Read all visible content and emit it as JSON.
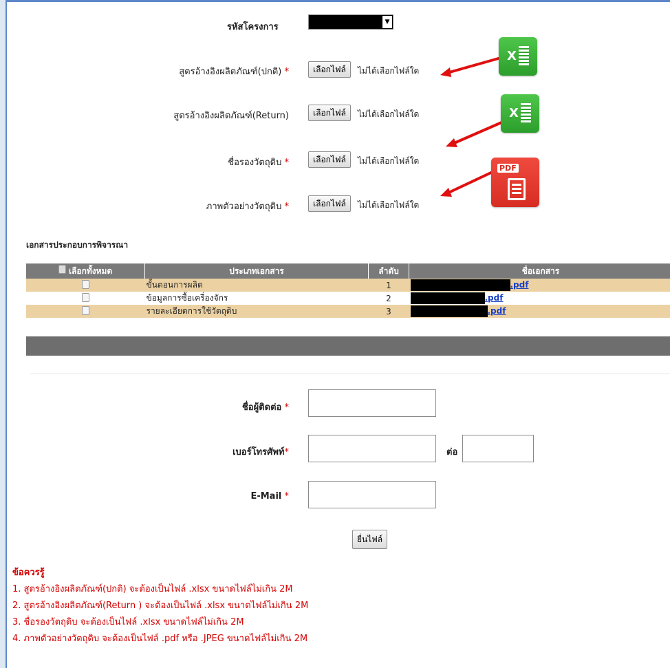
{
  "form": {
    "project_code_label": "รหัสโครงการ",
    "files": [
      {
        "label": "สูตรอ้างอิงผลิตภัณฑ์(ปกติ)",
        "required": true,
        "button": "เลือกไฟล์",
        "status": "ไม่ได้เลือกไฟล์ใด"
      },
      {
        "label": "สูตรอ้างอิงผลิตภัณฑ์(Return)",
        "required": false,
        "button": "เลือกไฟล์",
        "status": "ไม่ได้เลือกไฟล์ใด"
      },
      {
        "label": "ชื่อรองวัตถุดิบ",
        "required": true,
        "button": "เลือกไฟล์",
        "status": "ไม่ได้เลือกไฟล์ใด"
      },
      {
        "label": "ภาพตัวอย่างวัตถุดิบ",
        "required": true,
        "button": "เลือกไฟล์",
        "status": "ไม่ได้เลือกไฟล์ใด"
      }
    ],
    "required_mark": "*"
  },
  "icons": {
    "excel_letter": "X",
    "pdf_text": "PDF",
    "excel_color": "#2fa52f",
    "pdf_color": "#e0342a",
    "arrow_color": "#e01010"
  },
  "docs": {
    "section_title": "เอกสารประกอบการพิจารณา",
    "headers": {
      "select_all": "เลือกทั้งหมด",
      "type": "ประเภทเอกสาร",
      "order": "ลำดับ",
      "name": "ชื่อเอกสาร"
    },
    "rows": [
      {
        "type": "ขั้นตอนการผลิต",
        "order": "1",
        "ext": ".pdf"
      },
      {
        "type": "ข้อมูลการซื้อเครื่องจักร",
        "order": "2",
        "ext": ".pdf"
      },
      {
        "type": "รายละเอียดการใช้วัตถุดิบ",
        "order": "3",
        "ext": ".pdf"
      }
    ]
  },
  "contact": {
    "name_label": "ชื่อผู้ติดต่อ",
    "phone_label": "เบอร์โทรศัพท์",
    "ext_label": "ต่อ",
    "email_label": "E-Mail",
    "submit_label": "ยื่นไฟล์"
  },
  "notes": {
    "title": "ข้อควรรู้",
    "items": [
      "1. สูตรอ้างอิงผลิตภัณฑ์(ปกติ) จะต้องเป็นไฟล์ .xlsx ขนาดไฟล์ไม่เกิน 2M",
      "2. สูตรอ้างอิงผลิตภัณฑ์(Return ) จะต้องเป็นไฟล์ .xlsx ขนาดไฟล์ไม่เกิน 2M",
      "3. ชื่อรองวัตถุดิบ จะต้องเป็นไฟล์ .xlsx ขนาดไฟล์ไม่เกิน 2M",
      "4. ภาพตัวอย่างวัตถุดิบ จะต้องเป็นไฟล์ .pdf หรือ .JPEG ขนาดไฟล์ไม่เกิน 2M"
    ]
  }
}
